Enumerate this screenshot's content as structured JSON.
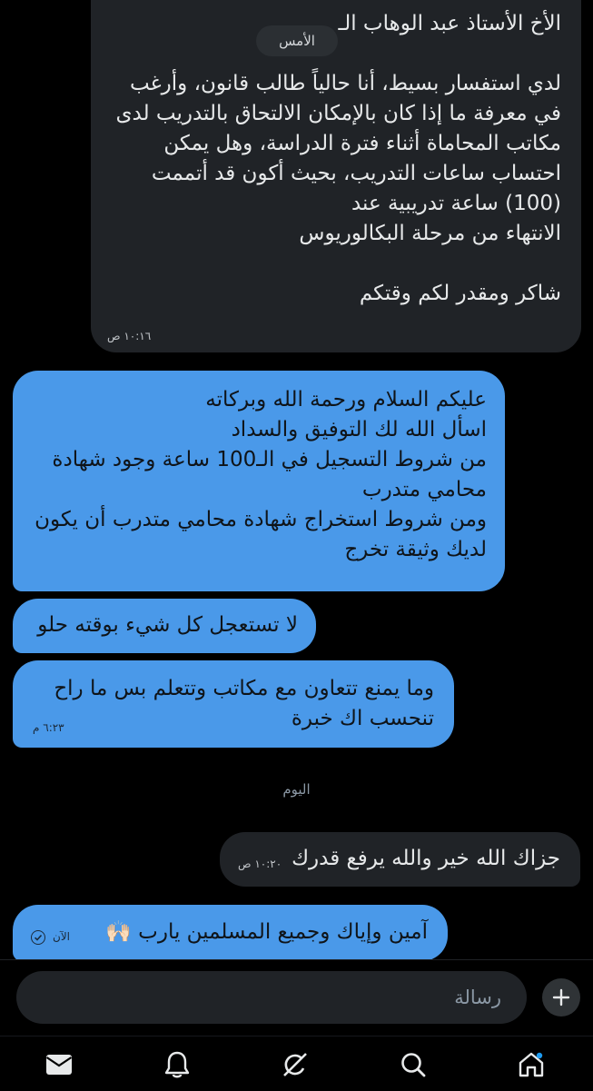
{
  "day_pill": "الأمس",
  "separator_today": "اليوم",
  "messages": {
    "m1": {
      "text": "الأخ الأستاذ عبد الوهاب الـ\n\nلدي استفسار بسيط، أنا حالياً طالب قانون، وأرغب في معرفة ما إذا كان بالإمكان الالتحاق بالتدريب لدى مكاتب المحاماة أثناء فترة الدراسة، وهل يمكن احتساب ساعات التدريب، بحيث أكون قد أتممت (100) ساعة تدريبية عند\nالانتهاء من مرحلة البكالوريوس\n\nشاكر ومقدر لكم وقتكم",
      "time": "١٠:١٦ ص"
    },
    "m2": {
      "text": "عليكم السلام ورحمة الله وبركاته\nاسأل الله لك التوفيق والسداد\nمن شروط التسجيل في الـ100 ساعة وجود شهادة محامي متدرب\nومن شروط استخراج شهادة محامي متدرب أن يكون لديك وثيقة تخرج"
    },
    "m3": {
      "text": "لا تستعجل كل شيء بوقته حلو"
    },
    "m4": {
      "text": "وما يمنع تتعاون مع مكاتب وتتعلم بس ما راح تنحسب اك خبرة",
      "time": "٦:٢٣ م"
    },
    "m5": {
      "text": "جزاك الله خير والله يرفع قدرك",
      "time": "١٠:٢٠ ص"
    },
    "m6": {
      "text": "آمين وإياك وجميع المسلمين يارب 🙌🏻",
      "time": "الآن"
    }
  },
  "composer": {
    "placeholder": "رسالة"
  },
  "nav_icons": [
    "home-icon",
    "search-icon",
    "grok-icon",
    "notifications-icon",
    "messages-icon"
  ],
  "colors": {
    "outgoing": "#4a99e9",
    "incoming": "#202327",
    "background": "#000000"
  }
}
